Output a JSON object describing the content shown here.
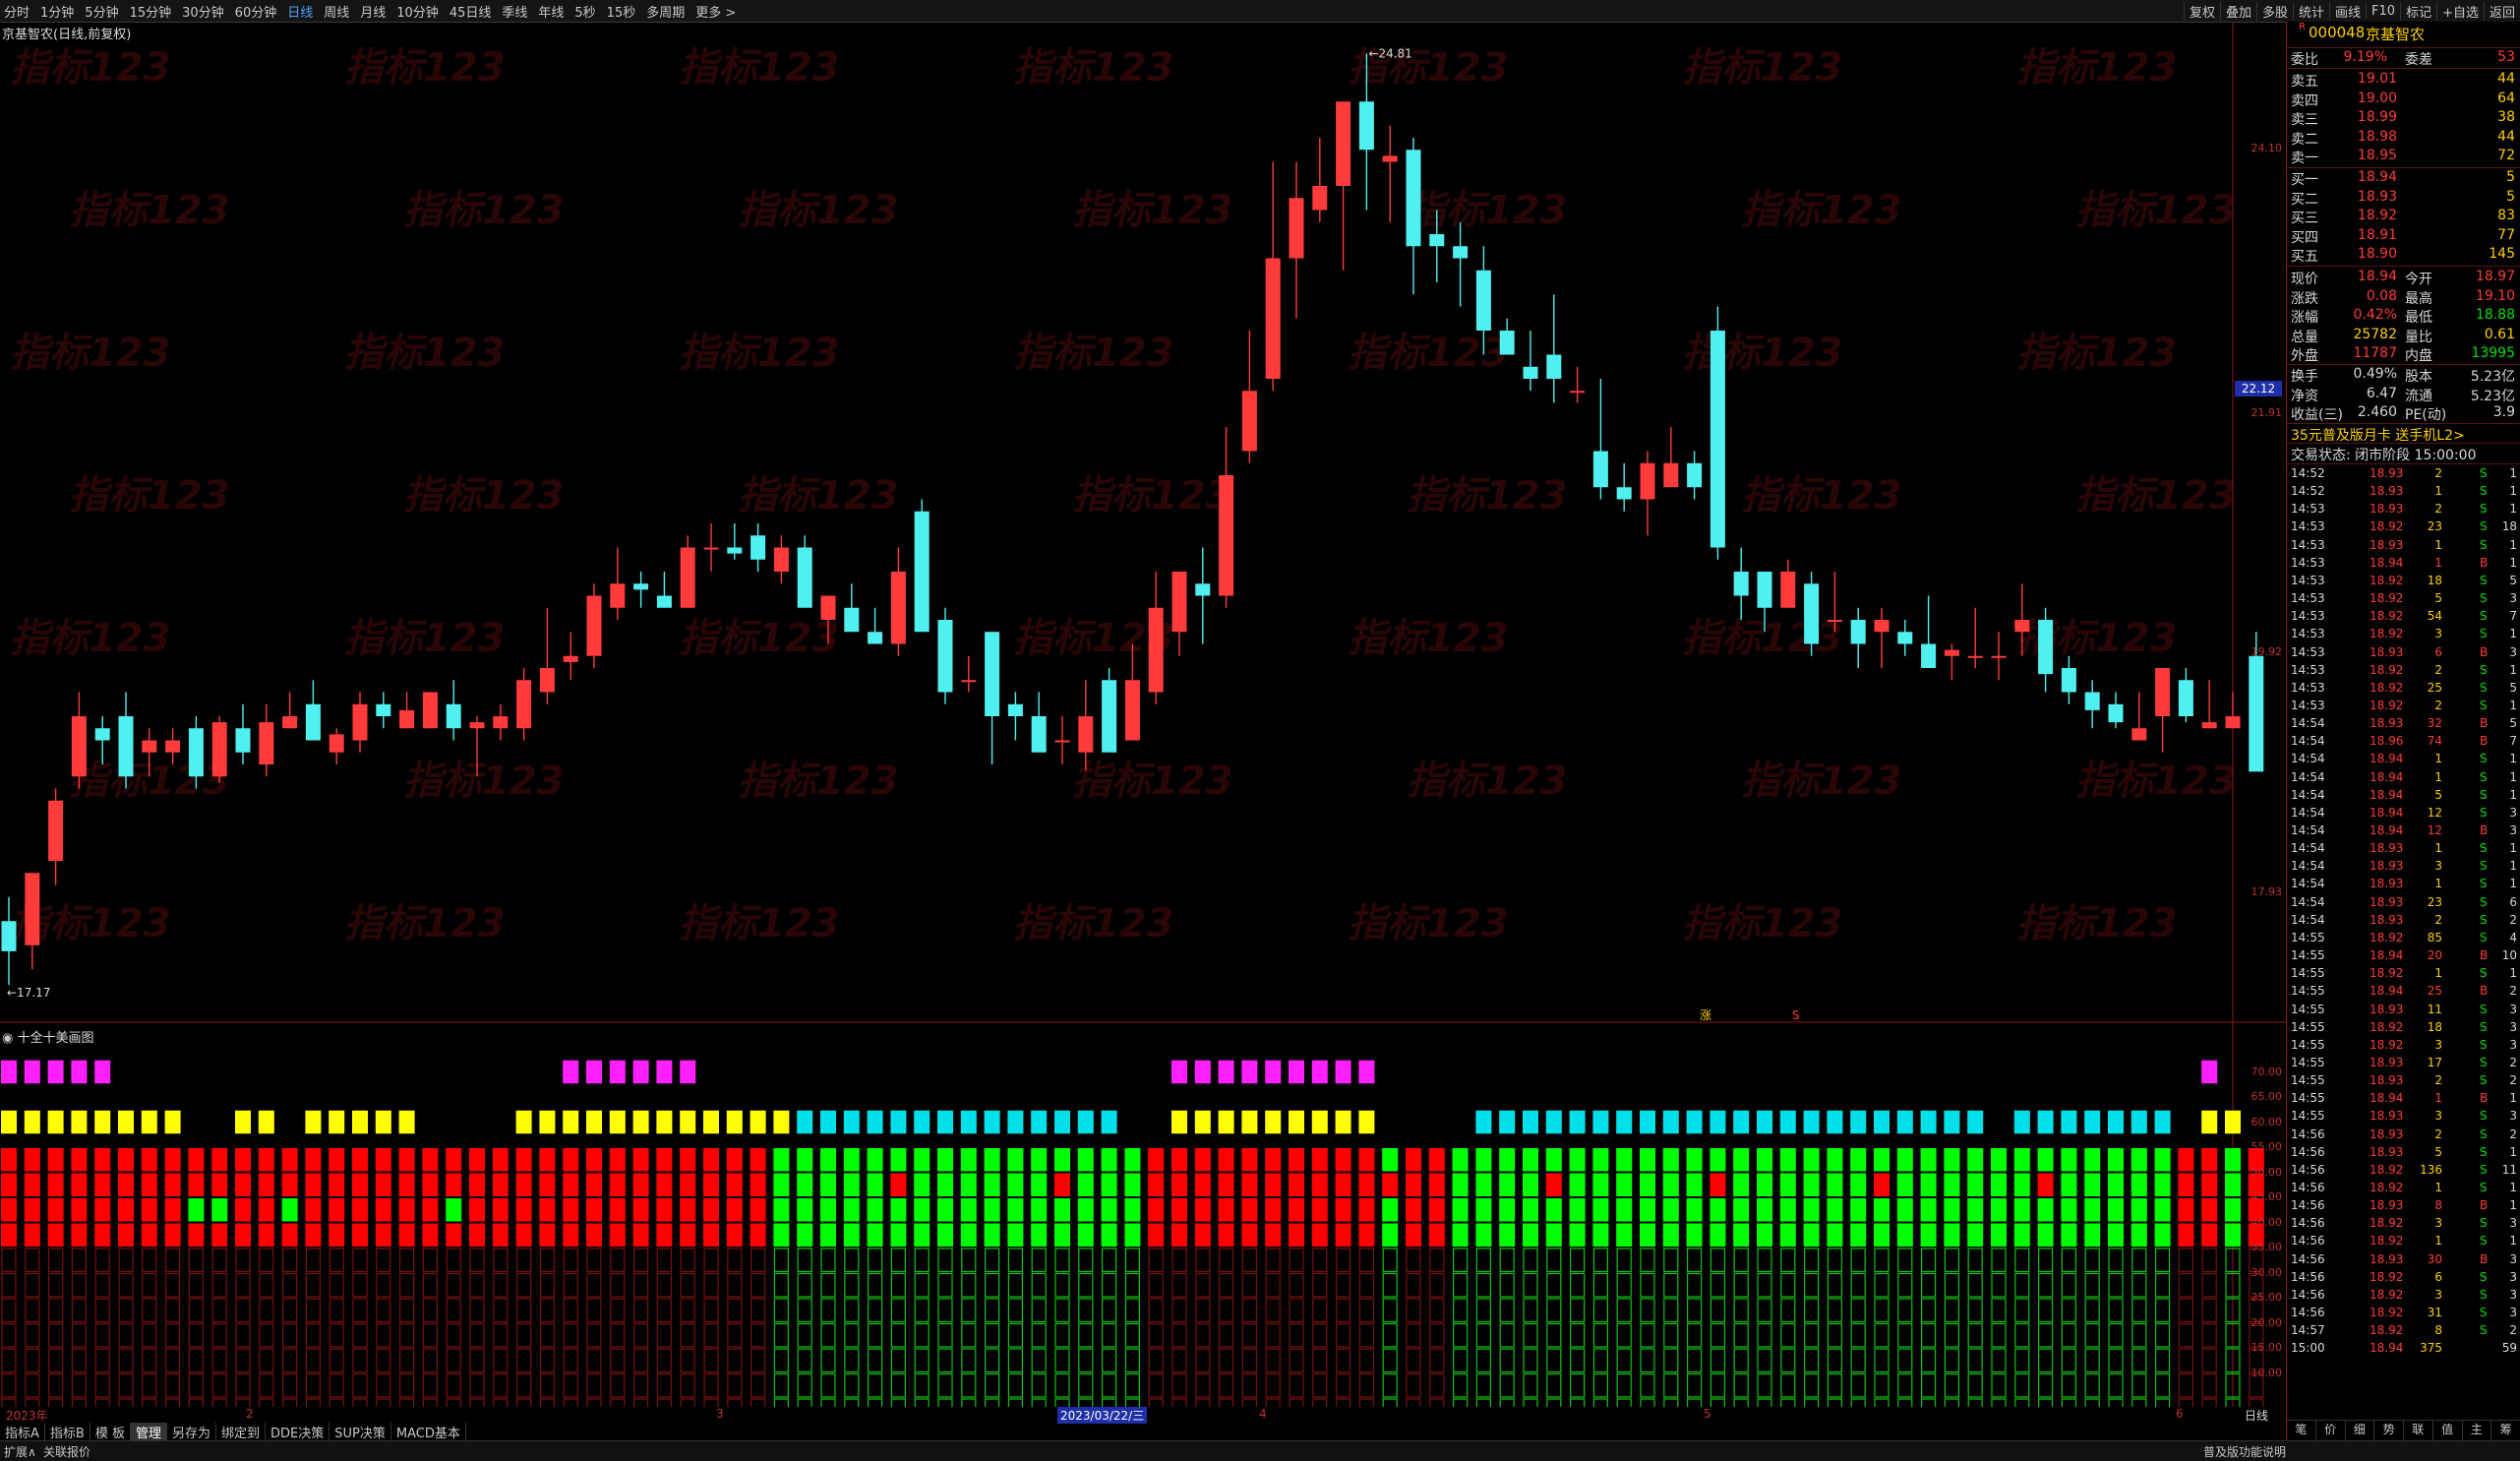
{
  "toolbar": {
    "periods": [
      "分时",
      "1分钟",
      "5分钟",
      "15分钟",
      "30分钟",
      "60分钟",
      "日线",
      "周线",
      "月线",
      "10分钟",
      "45日线",
      "季线",
      "年线",
      "5秒",
      "15秒",
      "多周期",
      "更多 >"
    ],
    "active_period": "日线",
    "right_tools": [
      "复权",
      "叠加",
      "多股",
      "统计",
      "画线",
      "F10",
      "标记",
      "+自选",
      "返回"
    ]
  },
  "chart": {
    "title": "京基智农(日线,前复权)",
    "high_label": "24.81",
    "low_label": "17.17",
    "current_price_tag": "22.12",
    "y_ticks": [
      "24.10",
      "21.91",
      "19.92",
      "17.93"
    ],
    "watermark": "指标123",
    "marks": [
      "涨",
      "S"
    ]
  },
  "indicator": {
    "title": "十全十美画图",
    "y_ticks": [
      "70.00",
      "65.00",
      "60.00",
      "55.00",
      "50.00",
      "45.00",
      "40.00",
      "35.00",
      "30.00",
      "25.00",
      "20.00",
      "15.00",
      "10.00"
    ]
  },
  "xaxis": {
    "labels": [
      "2023年",
      "2",
      "3",
      "4",
      "5",
      "6"
    ],
    "cursor_date": "2023/03/22/三",
    "right_label": "日线"
  },
  "bottom_tabs": [
    "指标A",
    "指标B",
    "模 板",
    "管理",
    "另存为",
    "绑定到",
    "DDE决策",
    "SUP决策",
    "MACD基本"
  ],
  "active_bottom_tab": "管理",
  "statusbar": {
    "left": [
      "扩展∧",
      "关联报价"
    ],
    "right": "普及版功能说明"
  },
  "quote": {
    "code": "000048",
    "name": "京基智农",
    "weibi_label": "委比",
    "weibi_value": "9.19%",
    "weicha_label": "委差",
    "weicha_value": "53",
    "asks": [
      {
        "label": "卖五",
        "price": "19.01",
        "vol": "44"
      },
      {
        "label": "卖四",
        "price": "19.00",
        "vol": "64"
      },
      {
        "label": "卖三",
        "price": "18.99",
        "vol": "38"
      },
      {
        "label": "卖二",
        "price": "18.98",
        "vol": "44"
      },
      {
        "label": "卖一",
        "price": "18.95",
        "vol": "72"
      }
    ],
    "bids": [
      {
        "label": "买一",
        "price": "18.94",
        "vol": "5"
      },
      {
        "label": "买二",
        "price": "18.93",
        "vol": "5"
      },
      {
        "label": "买三",
        "price": "18.92",
        "vol": "83"
      },
      {
        "label": "买四",
        "price": "18.91",
        "vol": "77"
      },
      {
        "label": "买五",
        "price": "18.90",
        "vol": "145"
      }
    ],
    "stats": [
      {
        "l1": "现价",
        "v1": "18.94",
        "l2": "今开",
        "v2": "18.97"
      },
      {
        "l1": "涨跌",
        "v1": "0.08",
        "l2": "最高",
        "v2": "19.10"
      },
      {
        "l1": "涨幅",
        "v1": "0.42%",
        "l2": "最低",
        "v2": "18.88"
      },
      {
        "l1": "总量",
        "v1": "25782",
        "l2": "量比",
        "v2": "0.61"
      },
      {
        "l1": "外盘",
        "v1": "11787",
        "l2": "内盘",
        "v2": "13995"
      }
    ],
    "stats2": [
      {
        "l1": "换手",
        "v1": "0.49%",
        "l2": "股本",
        "v2": "5.23亿"
      },
      {
        "l1": "净资",
        "v1": "6.47",
        "l2": "流通",
        "v2": "5.23亿"
      },
      {
        "l1": "收益(三)",
        "v1": "2.460",
        "l2": "PE(动)",
        "v2": "3.9"
      }
    ],
    "promo": "35元普及版月卡 送手机L2>",
    "trade_state": "交易状态: 闭市阶段 15:00:00",
    "panel_tabs": [
      "笔",
      "价",
      "细",
      "势",
      "联",
      "值",
      "主",
      "筹"
    ]
  },
  "ticks": [
    [
      "14:52",
      "18.93",
      "2",
      "S",
      "1"
    ],
    [
      "14:52",
      "18.93",
      "1",
      "S",
      "1"
    ],
    [
      "14:53",
      "18.93",
      "2",
      "S",
      "1"
    ],
    [
      "14:53",
      "18.92",
      "23",
      "S",
      "18"
    ],
    [
      "14:53",
      "18.93",
      "1",
      "S",
      "1"
    ],
    [
      "14:53",
      "18.94",
      "1",
      "B",
      "1"
    ],
    [
      "14:53",
      "18.92",
      "18",
      "S",
      "5"
    ],
    [
      "14:53",
      "18.92",
      "5",
      "S",
      "3"
    ],
    [
      "14:53",
      "18.92",
      "54",
      "S",
      "7"
    ],
    [
      "14:53",
      "18.92",
      "3",
      "S",
      "1"
    ],
    [
      "14:53",
      "18.93",
      "6",
      "B",
      "3"
    ],
    [
      "14:53",
      "18.92",
      "2",
      "S",
      "1"
    ],
    [
      "14:53",
      "18.92",
      "25",
      "S",
      "5"
    ],
    [
      "14:53",
      "18.92",
      "2",
      "S",
      "1"
    ],
    [
      "14:54",
      "18.93",
      "32",
      "B",
      "5"
    ],
    [
      "14:54",
      "18.96",
      "74",
      "B",
      "7"
    ],
    [
      "14:54",
      "18.94",
      "1",
      "S",
      "1"
    ],
    [
      "14:54",
      "18.94",
      "1",
      "S",
      "1"
    ],
    [
      "14:54",
      "18.94",
      "5",
      "S",
      "1"
    ],
    [
      "14:54",
      "18.94",
      "12",
      "S",
      "3"
    ],
    [
      "14:54",
      "18.94",
      "12",
      "B",
      "3"
    ],
    [
      "14:54",
      "18.93",
      "1",
      "S",
      "1"
    ],
    [
      "14:54",
      "18.93",
      "3",
      "S",
      "1"
    ],
    [
      "14:54",
      "18.93",
      "1",
      "S",
      "1"
    ],
    [
      "14:54",
      "18.93",
      "23",
      "S",
      "6"
    ],
    [
      "14:54",
      "18.93",
      "2",
      "S",
      "2"
    ],
    [
      "14:55",
      "18.92",
      "85",
      "S",
      "4"
    ],
    [
      "14:55",
      "18.94",
      "20",
      "B",
      "10"
    ],
    [
      "14:55",
      "18.92",
      "1",
      "S",
      "1"
    ],
    [
      "14:55",
      "18.94",
      "25",
      "B",
      "2"
    ],
    [
      "14:55",
      "18.93",
      "11",
      "S",
      "3"
    ],
    [
      "14:55",
      "18.92",
      "18",
      "S",
      "3"
    ],
    [
      "14:55",
      "18.92",
      "3",
      "S",
      "3"
    ],
    [
      "14:55",
      "18.93",
      "17",
      "S",
      "2"
    ],
    [
      "14:55",
      "18.93",
      "2",
      "S",
      "2"
    ],
    [
      "14:55",
      "18.94",
      "1",
      "B",
      "1"
    ],
    [
      "14:55",
      "18.93",
      "3",
      "S",
      "3"
    ],
    [
      "14:56",
      "18.93",
      "2",
      "S",
      "2"
    ],
    [
      "14:56",
      "18.93",
      "5",
      "S",
      "1"
    ],
    [
      "14:56",
      "18.92",
      "136",
      "S",
      "11"
    ],
    [
      "14:56",
      "18.92",
      "1",
      "S",
      "1"
    ],
    [
      "14:56",
      "18.93",
      "8",
      "B",
      "1"
    ],
    [
      "14:56",
      "18.92",
      "3",
      "S",
      "3"
    ],
    [
      "14:56",
      "18.92",
      "1",
      "S",
      "1"
    ],
    [
      "14:56",
      "18.93",
      "30",
      "B",
      "3"
    ],
    [
      "14:56",
      "18.92",
      "6",
      "S",
      "3"
    ],
    [
      "14:56",
      "18.92",
      "3",
      "S",
      "3"
    ],
    [
      "14:56",
      "18.92",
      "31",
      "S",
      "3"
    ],
    [
      "14:57",
      "18.92",
      "8",
      "S",
      "2"
    ],
    [
      "15:00",
      "18.94",
      "375",
      "",
      "59"
    ]
  ],
  "colors": {
    "up": "#ff3b3b",
    "down": "#50f0f0",
    "magenta": "#ff20ff",
    "yellow": "#ffff00",
    "cyan": "#00e0e8",
    "red": "#ff0000",
    "green": "#00ff00",
    "darkgreen": "#13c413",
    "darkred": "#7a1010"
  },
  "chart_data": {
    "type": "candlestick",
    "ohlc": [
      [
        17.7,
        17.9,
        17.17,
        17.45
      ],
      [
        17.5,
        18.1,
        17.3,
        18.1
      ],
      [
        18.2,
        18.8,
        18.0,
        18.7
      ],
      [
        18.9,
        19.6,
        18.8,
        19.4
      ],
      [
        19.3,
        19.4,
        19.0,
        19.2
      ],
      [
        19.4,
        19.6,
        18.8,
        18.9
      ],
      [
        19.1,
        19.3,
        18.9,
        19.2
      ],
      [
        19.1,
        19.3,
        19.0,
        19.2
      ],
      [
        19.3,
        19.4,
        18.8,
        18.9
      ],
      [
        18.9,
        19.4,
        18.85,
        19.35
      ],
      [
        19.3,
        19.5,
        19.0,
        19.1
      ],
      [
        19.0,
        19.5,
        18.9,
        19.35
      ],
      [
        19.3,
        19.6,
        19.3,
        19.4
      ],
      [
        19.5,
        19.7,
        19.3,
        19.2
      ],
      [
        19.1,
        19.3,
        19.0,
        19.25
      ],
      [
        19.2,
        19.6,
        19.1,
        19.5
      ],
      [
        19.5,
        19.6,
        19.3,
        19.4
      ],
      [
        19.3,
        19.6,
        19.3,
        19.45
      ],
      [
        19.3,
        19.6,
        19.3,
        19.6
      ],
      [
        19.5,
        19.7,
        19.2,
        19.3
      ],
      [
        19.3,
        19.4,
        18.9,
        19.35
      ],
      [
        19.3,
        19.5,
        19.2,
        19.4
      ],
      [
        19.3,
        19.8,
        19.2,
        19.7
      ],
      [
        19.6,
        20.3,
        19.5,
        19.8
      ],
      [
        19.85,
        20.1,
        19.7,
        19.9
      ],
      [
        19.9,
        20.5,
        19.8,
        20.4
      ],
      [
        20.3,
        20.8,
        20.2,
        20.5
      ],
      [
        20.5,
        20.6,
        20.3,
        20.45
      ],
      [
        20.4,
        20.6,
        20.3,
        20.3
      ],
      [
        20.3,
        20.9,
        20.3,
        20.8
      ],
      [
        20.8,
        21.0,
        20.6,
        20.8
      ],
      [
        20.8,
        21.0,
        20.7,
        20.75
      ],
      [
        20.9,
        21.0,
        20.6,
        20.7
      ],
      [
        20.6,
        20.9,
        20.5,
        20.8
      ],
      [
        20.8,
        20.9,
        20.5,
        20.3
      ],
      [
        20.2,
        20.4,
        20.0,
        20.4
      ],
      [
        20.3,
        20.5,
        20.2,
        20.1
      ],
      [
        20.1,
        20.3,
        20.0,
        20.0
      ],
      [
        20.0,
        20.8,
        19.9,
        20.6
      ],
      [
        21.1,
        21.2,
        20.4,
        20.1
      ],
      [
        20.2,
        20.3,
        19.5,
        19.6
      ],
      [
        19.7,
        19.9,
        19.6,
        19.7
      ],
      [
        20.1,
        20.1,
        19.0,
        19.4
      ],
      [
        19.5,
        19.6,
        19.2,
        19.4
      ],
      [
        19.4,
        19.6,
        19.2,
        19.1
      ],
      [
        19.2,
        19.4,
        19.0,
        19.2
      ],
      [
        19.1,
        19.7,
        18.95,
        19.4
      ],
      [
        19.7,
        19.8,
        19.1,
        19.1
      ],
      [
        19.2,
        20.0,
        19.2,
        19.7
      ],
      [
        19.6,
        20.6,
        19.5,
        20.3
      ],
      [
        20.1,
        20.4,
        19.9,
        20.6
      ],
      [
        20.5,
        20.8,
        20.0,
        20.4
      ],
      [
        20.4,
        21.8,
        20.3,
        21.4
      ],
      [
        21.6,
        22.6,
        21.5,
        22.1
      ],
      [
        22.2,
        24.0,
        22.1,
        23.2
      ],
      [
        23.2,
        24.0,
        22.7,
        23.7
      ],
      [
        23.6,
        24.2,
        23.5,
        23.8
      ],
      [
        23.8,
        24.4,
        23.1,
        24.5
      ],
      [
        24.5,
        24.9,
        23.6,
        24.1
      ],
      [
        24.0,
        24.3,
        23.5,
        24.05
      ],
      [
        24.1,
        24.2,
        22.9,
        23.3
      ],
      [
        23.4,
        23.6,
        23.0,
        23.3
      ],
      [
        23.3,
        23.5,
        22.8,
        23.2
      ],
      [
        23.1,
        23.3,
        22.4,
        22.6
      ],
      [
        22.6,
        22.7,
        22.4,
        22.4
      ],
      [
        22.3,
        22.6,
        22.1,
        22.2
      ],
      [
        22.4,
        22.9,
        22.0,
        22.2
      ],
      [
        22.1,
        22.3,
        22.0,
        22.1
      ],
      [
        21.6,
        22.2,
        21.2,
        21.3
      ],
      [
        21.3,
        21.5,
        21.1,
        21.2
      ],
      [
        21.2,
        21.6,
        20.9,
        21.5
      ],
      [
        21.3,
        21.8,
        21.3,
        21.5
      ],
      [
        21.5,
        21.6,
        21.2,
        21.3
      ],
      [
        22.6,
        22.8,
        20.7,
        20.8
      ],
      [
        20.6,
        20.8,
        20.2,
        20.4
      ],
      [
        20.6,
        20.6,
        20.1,
        20.3
      ],
      [
        20.3,
        20.7,
        20.3,
        20.6
      ],
      [
        20.5,
        20.6,
        19.9,
        20.0
      ],
      [
        20.2,
        20.6,
        20.1,
        20.2
      ],
      [
        20.2,
        20.3,
        19.8,
        20.0
      ],
      [
        20.1,
        20.3,
        19.8,
        20.2
      ],
      [
        20.1,
        20.2,
        19.9,
        20.0
      ],
      [
        20.0,
        20.4,
        19.85,
        19.8
      ],
      [
        19.9,
        20.0,
        19.7,
        19.95
      ],
      [
        19.9,
        20.3,
        19.8,
        19.9
      ],
      [
        19.9,
        20.1,
        19.7,
        19.9
      ],
      [
        20.1,
        20.5,
        19.9,
        20.2
      ],
      [
        20.2,
        20.3,
        19.6,
        19.75
      ],
      [
        19.8,
        19.9,
        19.5,
        19.6
      ],
      [
        19.6,
        19.7,
        19.3,
        19.45
      ],
      [
        19.5,
        19.6,
        19.3,
        19.35
      ],
      [
        19.2,
        19.6,
        19.2,
        19.3
      ],
      [
        19.4,
        19.8,
        19.1,
        19.8
      ],
      [
        19.7,
        19.8,
        19.35,
        19.4
      ],
      [
        19.3,
        19.7,
        19.3,
        19.35
      ],
      [
        19.3,
        19.6,
        19.3,
        19.4
      ],
      [
        19.9,
        20.1,
        19.4,
        18.94
      ]
    ],
    "ylim": [
      17.0,
      25.0
    ]
  }
}
